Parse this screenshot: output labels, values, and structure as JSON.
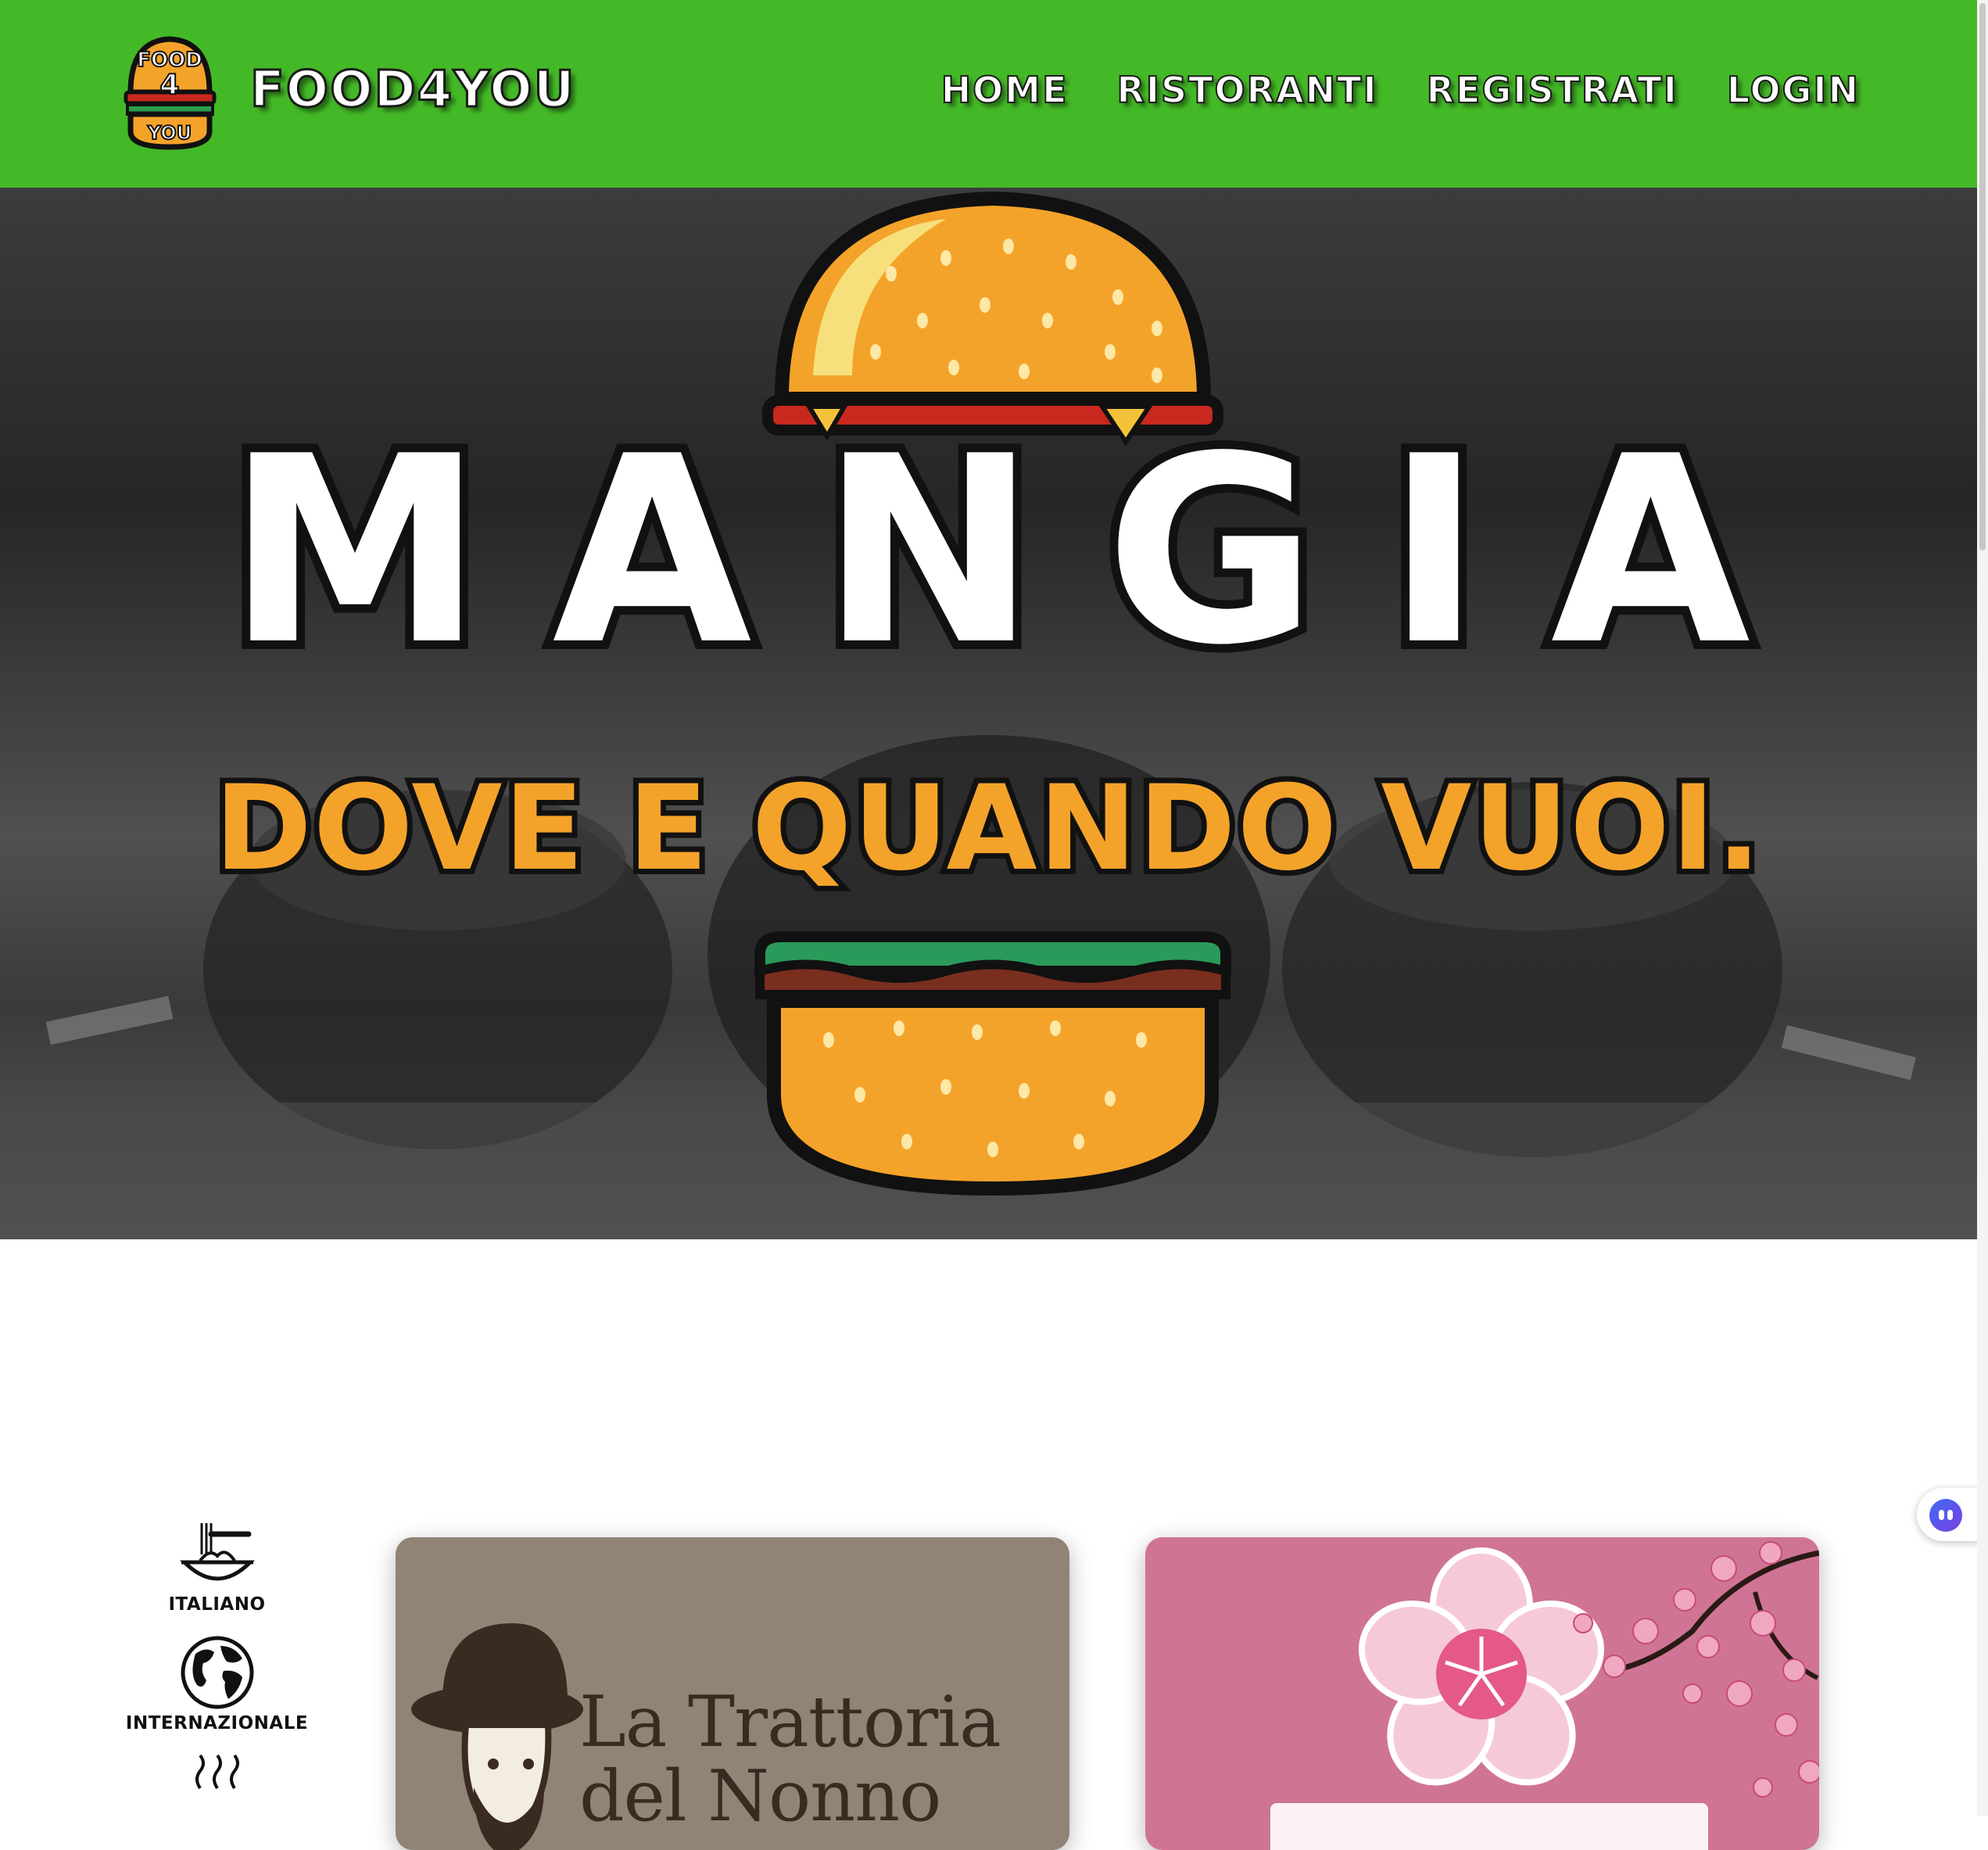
{
  "navbar": {
    "brand_name": "FOOD4YOU",
    "logo_text": {
      "line1": "FOOD",
      "line2": "4",
      "line3": "YOU"
    },
    "links": [
      "HOME",
      "RISTORANTI",
      "REGISTRATI",
      "LOGIN"
    ],
    "background_color": "#44b927"
  },
  "hero": {
    "title": "MANGIA",
    "subtitle": "DOVE E QUANDO VUOI.",
    "accent_color": "#f4a32a"
  },
  "categories": [
    {
      "label": "ITALIANO",
      "icon": "spaghetti-icon"
    },
    {
      "label": "INTERNAZIONALE",
      "icon": "globe-icon"
    },
    {
      "label": "",
      "icon": "steam-bowl-icon"
    }
  ],
  "restaurants": [
    {
      "name": "La Trattoria del Nonno",
      "bg_color": "#918476"
    },
    {
      "name": "",
      "bg_color": "#d07495"
    }
  ]
}
